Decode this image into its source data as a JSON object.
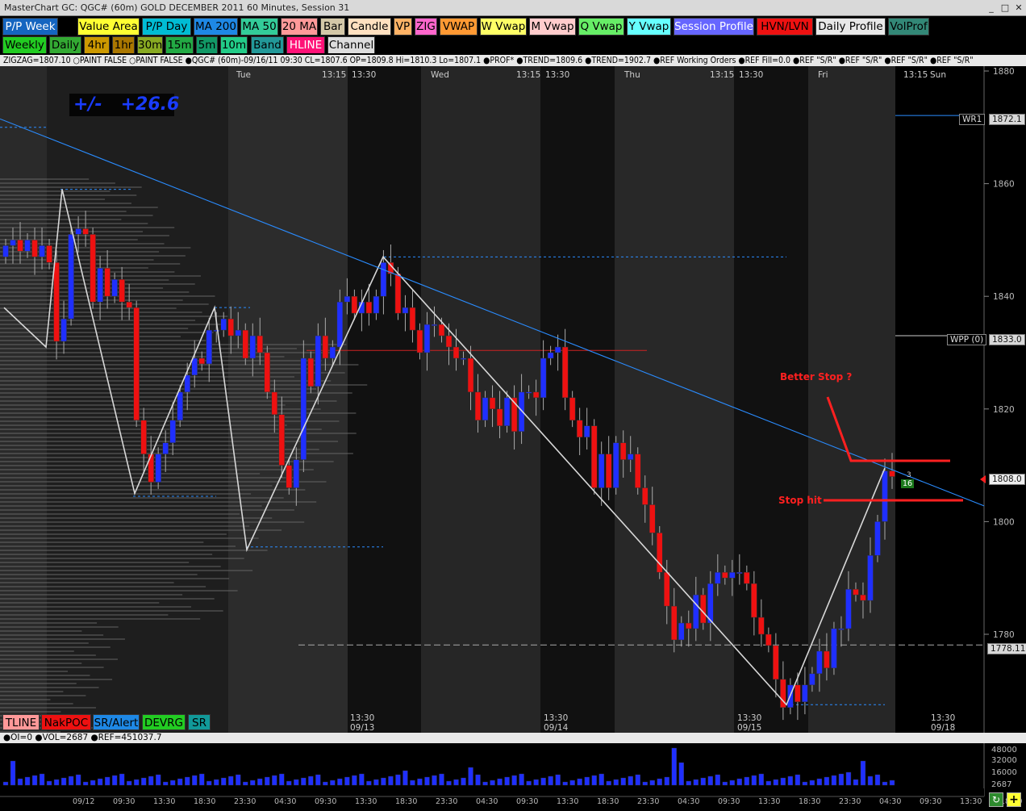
{
  "window": {
    "title": "MasterChart GC: QGC# (60m) GOLD DECEMBER 2011 60 Minutes, Session 31"
  },
  "toolbar_row1": [
    {
      "label": "P/P Week",
      "bg": "#1565c0",
      "fg": "#ffffff"
    },
    {
      "label": "Value Area",
      "bg": "#ffff33",
      "fg": "#000000"
    },
    {
      "label": "P/P Day",
      "bg": "#00bcd4",
      "fg": "#000000"
    },
    {
      "label": "MA 200",
      "bg": "#1e88e5",
      "fg": "#000000"
    },
    {
      "label": "MA 50",
      "bg": "#33cc99",
      "fg": "#000000"
    },
    {
      "label": "20 MA",
      "bg": "#ff9999",
      "fg": "#000000"
    },
    {
      "label": "Bar",
      "bg": "#d4c8a8",
      "fg": "#000000"
    },
    {
      "label": "Candle",
      "bg": "#ffe0c0",
      "fg": "#000000"
    },
    {
      "label": "VP",
      "bg": "#ffb366",
      "fg": "#000000"
    },
    {
      "label": "ZIG",
      "bg": "#ff66cc",
      "fg": "#000000"
    },
    {
      "label": "VWAP",
      "bg": "#ff9933",
      "fg": "#000000"
    },
    {
      "label": "W Vwap",
      "bg": "#ffff66",
      "fg": "#000000"
    },
    {
      "label": "M Vwap",
      "bg": "#ffcccc",
      "fg": "#000000"
    },
    {
      "label": "Q Vwap",
      "bg": "#66ee66",
      "fg": "#000000"
    },
    {
      "label": "Y Vwap",
      "bg": "#66ffff",
      "fg": "#000000"
    },
    {
      "label": "Session Profile",
      "bg": "#6666ff",
      "fg": "#ffffff"
    },
    {
      "label": "HVN/LVN",
      "bg": "#ee1111",
      "fg": "#000000"
    },
    {
      "label": "Daily Profile",
      "bg": "#e8e8e8",
      "fg": "#000000"
    },
    {
      "label": "VolProf",
      "bg": "#338877",
      "fg": "#000000"
    }
  ],
  "toolbar_row2": [
    {
      "label": "Weekly",
      "bg": "#22cc22",
      "fg": "#000000"
    },
    {
      "label": "Daily",
      "bg": "#33aa33",
      "fg": "#000000"
    },
    {
      "label": "4hr",
      "bg": "#cc9900",
      "fg": "#000000"
    },
    {
      "label": "1hr",
      "bg": "#aa7700",
      "fg": "#000000"
    },
    {
      "label": "30m",
      "bg": "#88aa22",
      "fg": "#000000"
    },
    {
      "label": "15m",
      "bg": "#22aa44",
      "fg": "#000000"
    },
    {
      "label": "5m",
      "bg": "#119966",
      "fg": "#000000"
    },
    {
      "label": "10m",
      "bg": "#22cc88",
      "fg": "#000000"
    },
    {
      "label": "Band",
      "bg": "#229999",
      "fg": "#000000"
    },
    {
      "label": "HLINE",
      "bg": "#ff1177",
      "fg": "#ffffff"
    },
    {
      "label": "Channel",
      "bg": "#dddddd",
      "fg": "#000000"
    }
  ],
  "info_line": "ZIGZAG=1807.10  ○PAINT FALSE  ○PAINT FALSE  ●QGC# (60m)-09/16/11 09:30 CL=1807.6 OP=1809.8 Hi=1810.3 Lo=1807.1  ●PROF*  ●TREND=1809.6  ●TREND=1902.7  ●REF Working Orders  ●REF Fill=0.0  ●REF \"S/R\"  ●REF \"S/R\"  ●REF \"S/R\"  ●REF \"S/R\"",
  "top_time_labels": [
    "Tue",
    "13:15",
    "13:30",
    "Wed",
    "13:15",
    "13:30",
    "Thu",
    "13:15",
    "13:30",
    "Fri",
    "13:15",
    "Sun"
  ],
  "bottom_date_labels": [
    {
      "time": "13:30",
      "date": "09/13"
    },
    {
      "time": "13:30",
      "date": "09/14"
    },
    {
      "time": "13:30",
      "date": "09/15"
    },
    {
      "time": "13:30",
      "date": "09/18"
    }
  ],
  "price_axis": [
    "1880",
    "1860",
    "1840",
    "1820",
    "1800",
    "1780"
  ],
  "price_tags": {
    "wr1_label": "WR1",
    "wr1_value": "1872.1",
    "wpp_label": "WPP (0)",
    "wpp_value": "1833.0",
    "last_value": "1808.0",
    "low_value": "1778.11"
  },
  "pl_display": {
    "sign": "+/-",
    "value": "+26.6"
  },
  "annotations": {
    "better_stop": "Better Stop ?",
    "stop_hit": "Stop hit"
  },
  "order_marker": {
    "qty": "3",
    "ticks": "16"
  },
  "bottom_tabs": [
    {
      "label": "TLINE",
      "bg": "#ff9999",
      "fg": "#000000"
    },
    {
      "label": "NakPOC",
      "bg": "#ee1111",
      "fg": "#000000"
    },
    {
      "label": "SR/Alert",
      "bg": "#1e88e5",
      "fg": "#000000"
    },
    {
      "label": "DEVRG",
      "bg": "#22cc22",
      "fg": "#000000"
    },
    {
      "label": "SR",
      "bg": "#119999",
      "fg": "#000000"
    }
  ],
  "volume_info": "●OI=0  ●VOL=2687  ●REF=451037.7",
  "volume_axis": [
    "48000",
    "32000",
    "16000",
    "2687"
  ],
  "volume_time_labels": [
    "09/12",
    "09:30",
    "13:30",
    "18:30",
    "23:30",
    "04:30",
    "09:30",
    "13:30",
    "18:30",
    "23:30",
    "04:30",
    "09:30",
    "13:30",
    "18:30",
    "23:30",
    "04:30",
    "09:30",
    "13:30",
    "18:30",
    "23:30",
    "04:30",
    "09:30",
    "13:30",
    "18:30"
  ],
  "colors": {
    "up": "#1f2fff",
    "down": "#ee1111",
    "zigzag": "#d8d8d8",
    "trendline": "#2a8cff",
    "annotation": "#ff2020"
  },
  "chart_data": {
    "type": "candlestick",
    "candles": [
      {
        "o": 1847,
        "c": 1849
      },
      {
        "o": 1849,
        "c": 1850
      },
      {
        "o": 1850,
        "c": 1848
      },
      {
        "o": 1848,
        "c": 1850
      },
      {
        "o": 1850,
        "c": 1847
      },
      {
        "o": 1847,
        "c": 1849
      },
      {
        "o": 1849,
        "c": 1846
      },
      {
        "o": 1846,
        "c": 1832
      },
      {
        "o": 1832,
        "c": 1836
      },
      {
        "o": 1836,
        "c": 1851
      },
      {
        "o": 1851,
        "c": 1852
      },
      {
        "o": 1852,
        "c": 1851
      },
      {
        "o": 1851,
        "c": 1839
      },
      {
        "o": 1839,
        "c": 1845
      },
      {
        "o": 1845,
        "c": 1840
      },
      {
        "o": 1840,
        "c": 1843
      },
      {
        "o": 1843,
        "c": 1839
      },
      {
        "o": 1839,
        "c": 1838
      },
      {
        "o": 1838,
        "c": 1818
      },
      {
        "o": 1818,
        "c": 1812
      },
      {
        "o": 1812,
        "c": 1807
      },
      {
        "o": 1807,
        "c": 1812
      },
      {
        "o": 1812,
        "c": 1814
      },
      {
        "o": 1814,
        "c": 1818
      },
      {
        "o": 1818,
        "c": 1823
      },
      {
        "o": 1823,
        "c": 1826
      },
      {
        "o": 1826,
        "c": 1829
      },
      {
        "o": 1829,
        "c": 1828
      },
      {
        "o": 1828,
        "c": 1834
      },
      {
        "o": 1834,
        "c": 1834
      },
      {
        "o": 1834,
        "c": 1836
      },
      {
        "o": 1836,
        "c": 1833
      },
      {
        "o": 1833,
        "c": 1834
      },
      {
        "o": 1834,
        "c": 1829
      },
      {
        "o": 1829,
        "c": 1833
      },
      {
        "o": 1833,
        "c": 1830
      },
      {
        "o": 1830,
        "c": 1823
      },
      {
        "o": 1823,
        "c": 1819
      },
      {
        "o": 1819,
        "c": 1810
      },
      {
        "o": 1810,
        "c": 1806
      },
      {
        "o": 1806,
        "c": 1811
      },
      {
        "o": 1811,
        "c": 1829
      },
      {
        "o": 1829,
        "c": 1824
      },
      {
        "o": 1824,
        "c": 1833
      },
      {
        "o": 1833,
        "c": 1829
      },
      {
        "o": 1829,
        "c": 1831
      },
      {
        "o": 1831,
        "c": 1839
      },
      {
        "o": 1839,
        "c": 1840
      },
      {
        "o": 1840,
        "c": 1837
      },
      {
        "o": 1837,
        "c": 1839
      },
      {
        "o": 1839,
        "c": 1837
      },
      {
        "o": 1837,
        "c": 1840
      },
      {
        "o": 1840,
        "c": 1846
      },
      {
        "o": 1846,
        "c": 1844
      },
      {
        "o": 1844,
        "c": 1837
      },
      {
        "o": 1837,
        "c": 1838
      },
      {
        "o": 1838,
        "c": 1834
      },
      {
        "o": 1834,
        "c": 1830
      },
      {
        "o": 1830,
        "c": 1835
      },
      {
        "o": 1835,
        "c": 1835
      },
      {
        "o": 1835,
        "c": 1833
      },
      {
        "o": 1833,
        "c": 1831
      },
      {
        "o": 1831,
        "c": 1829
      },
      {
        "o": 1829,
        "c": 1829
      },
      {
        "o": 1829,
        "c": 1823
      },
      {
        "o": 1823,
        "c": 1818
      },
      {
        "o": 1818,
        "c": 1822
      },
      {
        "o": 1822,
        "c": 1820
      },
      {
        "o": 1820,
        "c": 1817
      },
      {
        "o": 1817,
        "c": 1822
      },
      {
        "o": 1822,
        "c": 1816
      },
      {
        "o": 1816,
        "c": 1823
      },
      {
        "o": 1823,
        "c": 1823
      },
      {
        "o": 1823,
        "c": 1822
      },
      {
        "o": 1822,
        "c": 1829
      },
      {
        "o": 1829,
        "c": 1830
      },
      {
        "o": 1830,
        "c": 1831
      },
      {
        "o": 1831,
        "c": 1822
      },
      {
        "o": 1822,
        "c": 1818
      },
      {
        "o": 1818,
        "c": 1815
      },
      {
        "o": 1815,
        "c": 1817
      },
      {
        "o": 1817,
        "c": 1806
      },
      {
        "o": 1806,
        "c": 1812
      },
      {
        "o": 1812,
        "c": 1806
      },
      {
        "o": 1806,
        "c": 1814
      },
      {
        "o": 1814,
        "c": 1811
      },
      {
        "o": 1811,
        "c": 1812
      },
      {
        "o": 1812,
        "c": 1806
      },
      {
        "o": 1806,
        "c": 1803
      },
      {
        "o": 1803,
        "c": 1798
      },
      {
        "o": 1798,
        "c": 1791
      },
      {
        "o": 1791,
        "c": 1785
      },
      {
        "o": 1785,
        "c": 1779
      },
      {
        "o": 1779,
        "c": 1782
      },
      {
        "o": 1782,
        "c": 1781
      },
      {
        "o": 1781,
        "c": 1787
      },
      {
        "o": 1787,
        "c": 1782
      },
      {
        "o": 1782,
        "c": 1789
      },
      {
        "o": 1789,
        "c": 1791
      },
      {
        "o": 1791,
        "c": 1790
      },
      {
        "o": 1790,
        "c": 1791
      },
      {
        "o": 1791,
        "c": 1791
      },
      {
        "o": 1791,
        "c": 1789
      },
      {
        "o": 1789,
        "c": 1783
      },
      {
        "o": 1783,
        "c": 1780
      },
      {
        "o": 1780,
        "c": 1778
      },
      {
        "o": 1778,
        "c": 1772
      },
      {
        "o": 1772,
        "c": 1767
      },
      {
        "o": 1767,
        "c": 1771
      },
      {
        "o": 1771,
        "c": 1768
      },
      {
        "o": 1768,
        "c": 1771
      },
      {
        "o": 1771,
        "c": 1773
      },
      {
        "o": 1773,
        "c": 1777
      },
      {
        "o": 1777,
        "c": 1774
      },
      {
        "o": 1774,
        "c": 1781
      },
      {
        "o": 1781,
        "c": 1781
      },
      {
        "o": 1781,
        "c": 1788
      },
      {
        "o": 1788,
        "c": 1787
      },
      {
        "o": 1787,
        "c": 1786
      },
      {
        "o": 1786,
        "c": 1794
      },
      {
        "o": 1794,
        "c": 1800
      },
      {
        "o": 1800,
        "c": 1809
      },
      {
        "o": 1809,
        "c": 1808
      }
    ],
    "zigzag_prices": [
      1844,
      1831,
      1859,
      1812,
      1835,
      1806,
      1837,
      1792,
      1846,
      1790,
      1768,
      1809.5
    ],
    "y_range": [
      1764,
      1882
    ]
  }
}
